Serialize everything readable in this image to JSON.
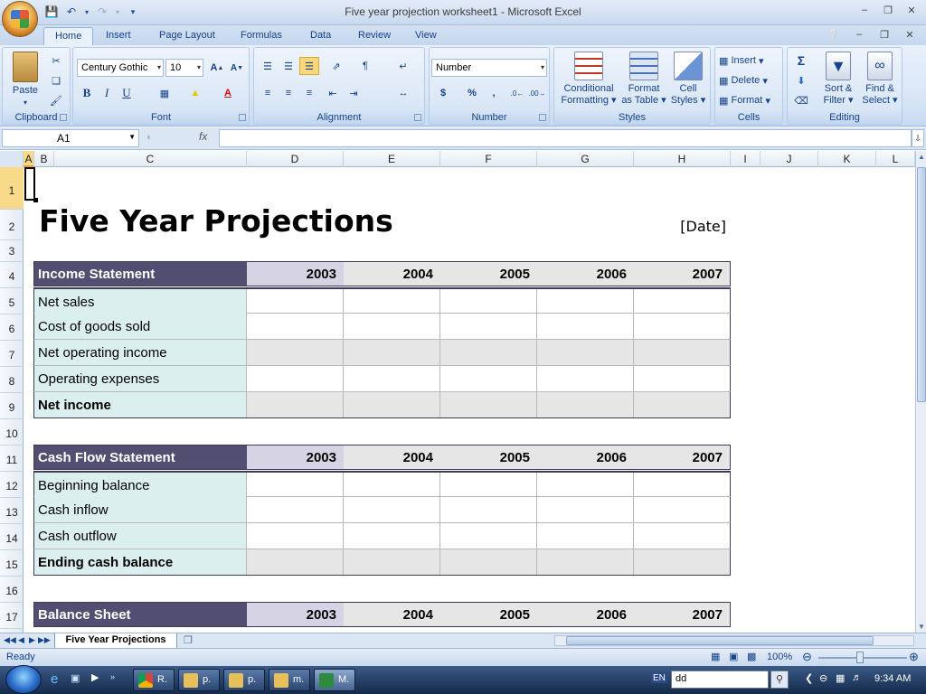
{
  "window": {
    "title": "Five year projection worksheet1 - Microsoft Excel"
  },
  "ribbon": {
    "tabs": [
      {
        "label": "Home"
      },
      {
        "label": "Insert"
      },
      {
        "label": "Page Layout"
      },
      {
        "label": "Formulas"
      },
      {
        "label": "Data"
      },
      {
        "label": "Review"
      },
      {
        "label": "View"
      }
    ],
    "active_tab": "Home",
    "groups": {
      "clipboard": "Clipboard",
      "font": "Font",
      "alignment": "Alignment",
      "number": "Number",
      "styles": "Styles",
      "cells": "Cells",
      "editing": "Editing"
    },
    "paste_label": "Paste",
    "font_name": "Century Gothic",
    "font_size": "10",
    "number_format": "Number",
    "bold": "B",
    "italic": "I",
    "underline": "U",
    "currency": "$",
    "percent": "%",
    "comma": ",",
    "cond_format_1": "Conditional",
    "cond_format_2": "Formatting",
    "format_table_1": "Format",
    "format_table_2": "as Table",
    "cell_styles_1": "Cell",
    "cell_styles_2": "Styles",
    "insert_label": "Insert",
    "delete_label": "Delete",
    "format_label": "Format",
    "sort_1": "Sort &",
    "sort_2": "Filter",
    "find_1": "Find &",
    "find_2": "Select"
  },
  "formula_bar": {
    "name_box": "A1",
    "fx": "fx",
    "value": ""
  },
  "columns": [
    "A",
    "B",
    "C",
    "D",
    "E",
    "F",
    "G",
    "H",
    "I",
    "J",
    "K",
    "L"
  ],
  "rows": [
    "1",
    "2",
    "3",
    "4",
    "5",
    "6",
    "7",
    "8",
    "9",
    "10",
    "11",
    "12",
    "13",
    "14",
    "15",
    "16",
    "17"
  ],
  "sheet": {
    "title": "Five Year Projections",
    "date": "[Date]",
    "years": [
      "2003",
      "2004",
      "2005",
      "2006",
      "2007"
    ],
    "income": {
      "header": "Income Statement",
      "rows": [
        "Net sales",
        "Cost of goods sold",
        "Net operating income",
        "Operating expenses",
        "Net income"
      ]
    },
    "cash": {
      "header": "Cash Flow Statement",
      "rows": [
        "Beginning balance",
        "Cash inflow",
        "Cash outflow",
        "Ending cash balance"
      ]
    },
    "balance": {
      "header": "Balance Sheet"
    }
  },
  "sheet_tab": "Five Year Projections",
  "status": {
    "ready": "Ready",
    "zoom": "100%"
  },
  "taskbar": {
    "items": [
      "R.",
      "p.",
      "p.",
      "m.",
      "M."
    ],
    "lang": "EN",
    "search": "dd",
    "time": "9:34 AM"
  }
}
